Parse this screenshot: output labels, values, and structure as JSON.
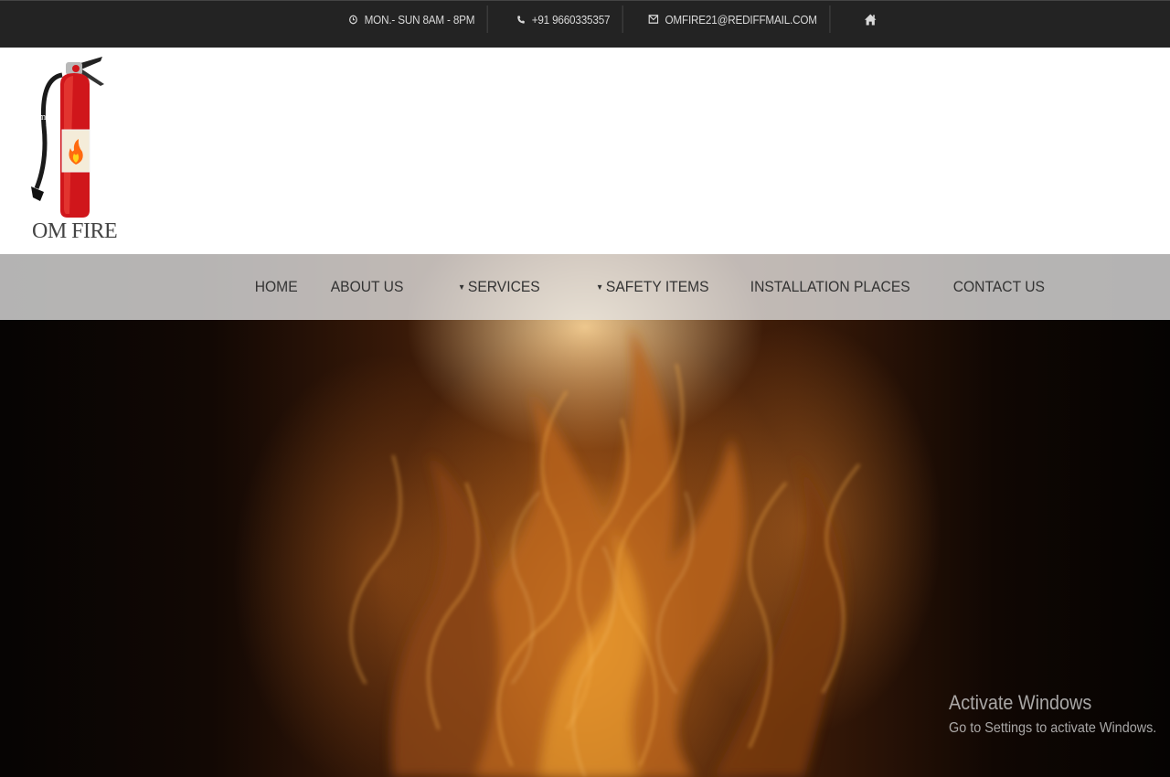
{
  "topbar": {
    "hours": "MON.- SUN 8AM - 8PM",
    "phone": "+91 9660335357",
    "email": "OMFIRE21@REDIFFMAIL.COM",
    "icons": {
      "hours": "clock-icon",
      "phone": "phone-icon",
      "email": "envelope-icon",
      "home": "home-icon"
    }
  },
  "logo": {
    "badge_text": "omfire",
    "name": "OM FIRE"
  },
  "nav": {
    "items": [
      {
        "label": "HOME",
        "dropdown": false
      },
      {
        "label": "ABOUT US",
        "dropdown": false
      },
      {
        "label": "SERVICES",
        "dropdown": true
      },
      {
        "label": "SAFETY ITEMS",
        "dropdown": true
      },
      {
        "label": "INSTALLATION PLACES",
        "dropdown": false
      },
      {
        "label": "CONTACT US",
        "dropdown": false
      }
    ]
  },
  "watermark": {
    "title": "Activate Windows",
    "subtitle": "Go to Settings to activate Windows."
  },
  "colors": {
    "topbar_bg": "#232323",
    "extinguisher_red": "#d0161b",
    "nav_bg": "#e6e6e6"
  }
}
